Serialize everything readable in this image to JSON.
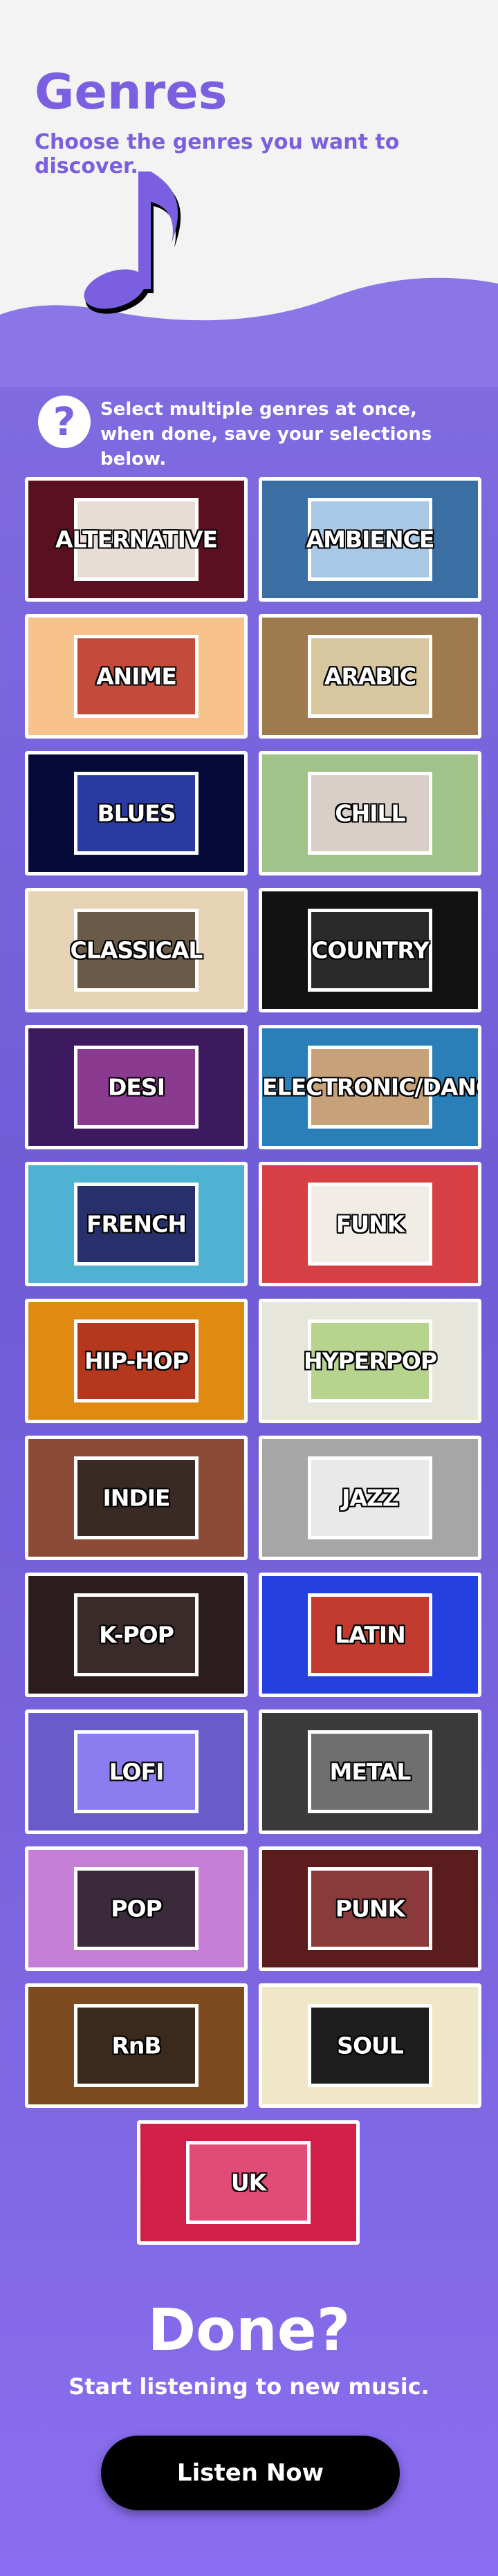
{
  "header": {
    "title": "Genres",
    "subtitle": "Choose the genres you want to discover.",
    "icon": "music-note-icon"
  },
  "help": {
    "icon": "question-icon",
    "line1": "Select multiple genres at once,",
    "line2": "when done, save your selections below."
  },
  "genres": [
    {
      "label": "ALTERNATIVE",
      "bg": "#5a1020",
      "art": "#e8ddd6"
    },
    {
      "label": "AMBIENCE",
      "bg": "#3b6fa3",
      "art": "#a9c8e6"
    },
    {
      "label": "ANIME",
      "bg": "#f7c28b",
      "art": "#c24b3c"
    },
    {
      "label": "ARABIC",
      "bg": "#9e7b4e",
      "art": "#d8c6a1"
    },
    {
      "label": "BLUES",
      "bg": "#060a38",
      "art": "#2a3aa0"
    },
    {
      "label": "CHILL",
      "bg": "#9fc389",
      "art": "#d9cfc8"
    },
    {
      "label": "CLASSICAL",
      "bg": "#e6d3b6",
      "art": "#6a5a48"
    },
    {
      "label": "COUNTRY",
      "bg": "#121212",
      "art": "#2a2a2a"
    },
    {
      "label": "DESI",
      "bg": "#3d1a5f",
      "art": "#8a3a8f"
    },
    {
      "label": "ELECTRONIC/DANCE",
      "bg": "#2a7fb8",
      "art": "#c7a17a"
    },
    {
      "label": "FRENCH",
      "bg": "#4fb2d3",
      "art": "#27306a"
    },
    {
      "label": "FUNK",
      "bg": "#d64045",
      "art": "#f2ece6"
    },
    {
      "label": "HIP-HOP",
      "bg": "#e08a12",
      "art": "#b3381d"
    },
    {
      "label": "HYPERPOP",
      "bg": "#e6e6dc",
      "art": "#b7d48f"
    },
    {
      "label": "INDIE",
      "bg": "#8c4b36",
      "art": "#3a2a24"
    },
    {
      "label": "JAZZ",
      "bg": "#a6a6a6",
      "art": "#e9e9e9"
    },
    {
      "label": "K-POP",
      "bg": "#2b1d1d",
      "art": "#3a2b2a"
    },
    {
      "label": "LATIN",
      "bg": "#2440e0",
      "art": "#c23b2f"
    },
    {
      "label": "LOFI",
      "bg": "#6a5cc8",
      "art": "#8b7cf0"
    },
    {
      "label": "METAL",
      "bg": "#3a3a3a",
      "art": "#6f6f6f"
    },
    {
      "label": "POP",
      "bg": "#c77ed6",
      "art": "#3a2a3a"
    },
    {
      "label": "PUNK",
      "bg": "#5a1c1c",
      "art": "#8a3a3a"
    },
    {
      "label": "RnB",
      "bg": "#7e4a1f",
      "art": "#3b2a1c"
    },
    {
      "label": "SOUL",
      "bg": "#efe7c7",
      "art": "#1e1e1e"
    },
    {
      "label": "UK",
      "bg": "#d21f4a",
      "art": "#e24a77"
    }
  ],
  "footer": {
    "done_title": "Done?",
    "done_subtitle": "Start listening to new music.",
    "cta_label": "Listen Now"
  }
}
